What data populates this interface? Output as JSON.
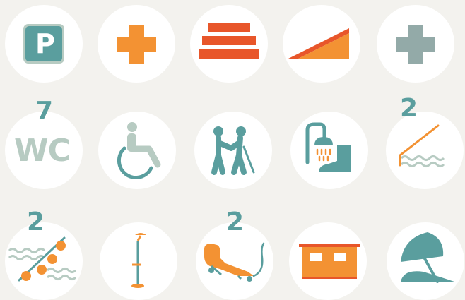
{
  "colors": {
    "background": "#f3f2ee",
    "circle": "#ffffff",
    "teal": "#5a9e9e",
    "orange": "#f39233",
    "red_orange": "#e8562a",
    "grey_teal": "#93aaa8",
    "pale_green": "#b7cbc2",
    "teal_light": "#9ecfcc"
  },
  "icons": [
    {
      "name": "parking-icon",
      "label": "P"
    },
    {
      "name": "first-aid-icon"
    },
    {
      "name": "steps-icon"
    },
    {
      "name": "ramp-icon"
    },
    {
      "name": "medical-cross-icon"
    },
    {
      "name": "wc-icon",
      "label": "WC",
      "count": "7"
    },
    {
      "name": "wheelchair-icon"
    },
    {
      "name": "assisted-walking-icon"
    },
    {
      "name": "foot-shower-icon"
    },
    {
      "name": "pool-ramp-icon",
      "count": "2"
    },
    {
      "name": "floating-walkway-icon",
      "count": "2"
    },
    {
      "name": "shower-post-icon"
    },
    {
      "name": "amphibious-chair-icon",
      "count": "2"
    },
    {
      "name": "beach-hut-icon"
    },
    {
      "name": "beach-umbrella-icon"
    }
  ]
}
